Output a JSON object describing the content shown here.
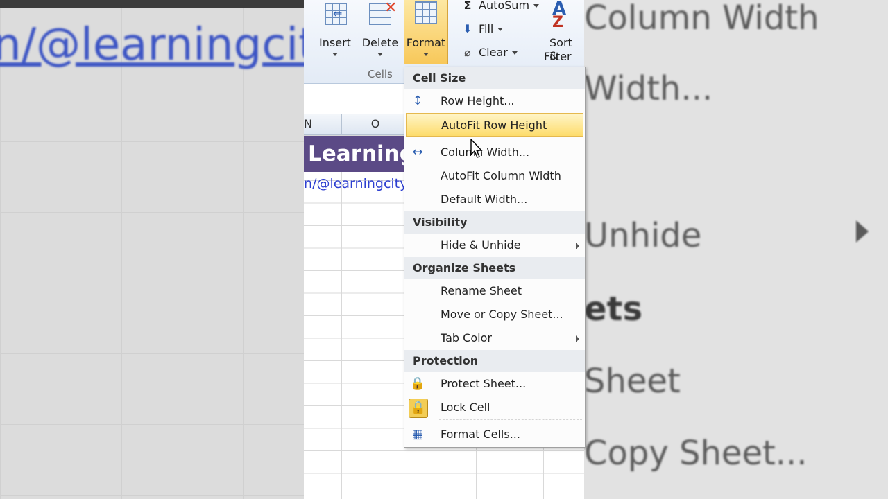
{
  "background": {
    "left_link_text": "n/@learningcity",
    "right_texts": [
      "Column Width",
      "Width...",
      "Unhide",
      "ets",
      "Sheet",
      "Copy Sheet..."
    ]
  },
  "ribbon": {
    "insert_label": "Insert",
    "delete_label": "Delete",
    "format_label": "Format",
    "cells_group_label": "Cells",
    "autosum_label": "AutoSum",
    "fill_label": "Fill",
    "clear_label": "Clear",
    "sort_label_1": "Sort &",
    "sort_label_2": "Filter"
  },
  "sheet": {
    "columns": [
      "N",
      "O"
    ],
    "banner_text": "Learning",
    "link_text": "n/@learningcity"
  },
  "menu": {
    "sections": {
      "cell_size": "Cell Size",
      "visibility": "Visibility",
      "organize": "Organize Sheets",
      "protection": "Protection"
    },
    "items": {
      "row_height": "Row Height...",
      "autofit_row": "AutoFit Row Height",
      "column_width": "Column Width...",
      "autofit_column": "AutoFit Column Width",
      "default_width": "Default Width...",
      "hide_unhide": "Hide & Unhide",
      "rename_sheet": "Rename Sheet",
      "move_copy": "Move or Copy Sheet...",
      "tab_color": "Tab Color",
      "protect_sheet": "Protect Sheet...",
      "lock_cell": "Lock Cell",
      "format_cells": "Format Cells..."
    },
    "highlighted_item": "autofit_row"
  },
  "colors": {
    "accent_highlight": "#fddc6c",
    "banner": "#5b4a86",
    "link": "#2d3fd0"
  }
}
